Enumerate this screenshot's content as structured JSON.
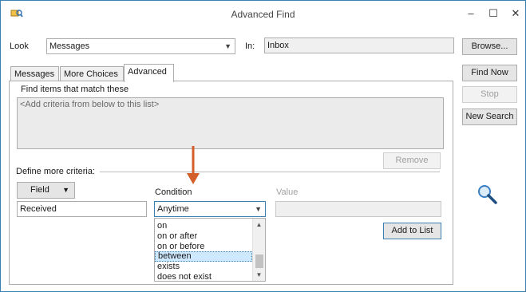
{
  "window": {
    "title": "Advanced Find",
    "minimize": "–",
    "maximize": "☐",
    "close": "✕"
  },
  "look": {
    "label": "Look",
    "value": "Messages"
  },
  "in": {
    "label": "In:",
    "value": "Inbox"
  },
  "buttons": {
    "browse": "Browse...",
    "find_now": "Find Now",
    "stop": "Stop",
    "new_search": "New Search",
    "remove": "Remove",
    "add_to_list": "Add to List"
  },
  "tabs": [
    {
      "label": "Messages"
    },
    {
      "label": "More Choices"
    },
    {
      "label": "Advanced"
    }
  ],
  "advanced": {
    "find_items_label": "Find items that match these",
    "criteria_placeholder": "<Add criteria from below to this list>",
    "define_more_label": "Define more criteria:",
    "field_button": "Field",
    "field_value": "Received",
    "condition_label": "Condition",
    "condition_value": "Anytime",
    "value_label": "Value",
    "condition_options": [
      "on",
      "on or after",
      "on or before",
      "between",
      "exists",
      "does not exist"
    ],
    "selected_option": "between"
  },
  "colors": {
    "arrow": "#d35e2a",
    "selection": "#cde8ff",
    "accent": "#3c7fb1"
  },
  "icons": {
    "app": "advanced-find-icon",
    "search": "magnifier-icon"
  }
}
